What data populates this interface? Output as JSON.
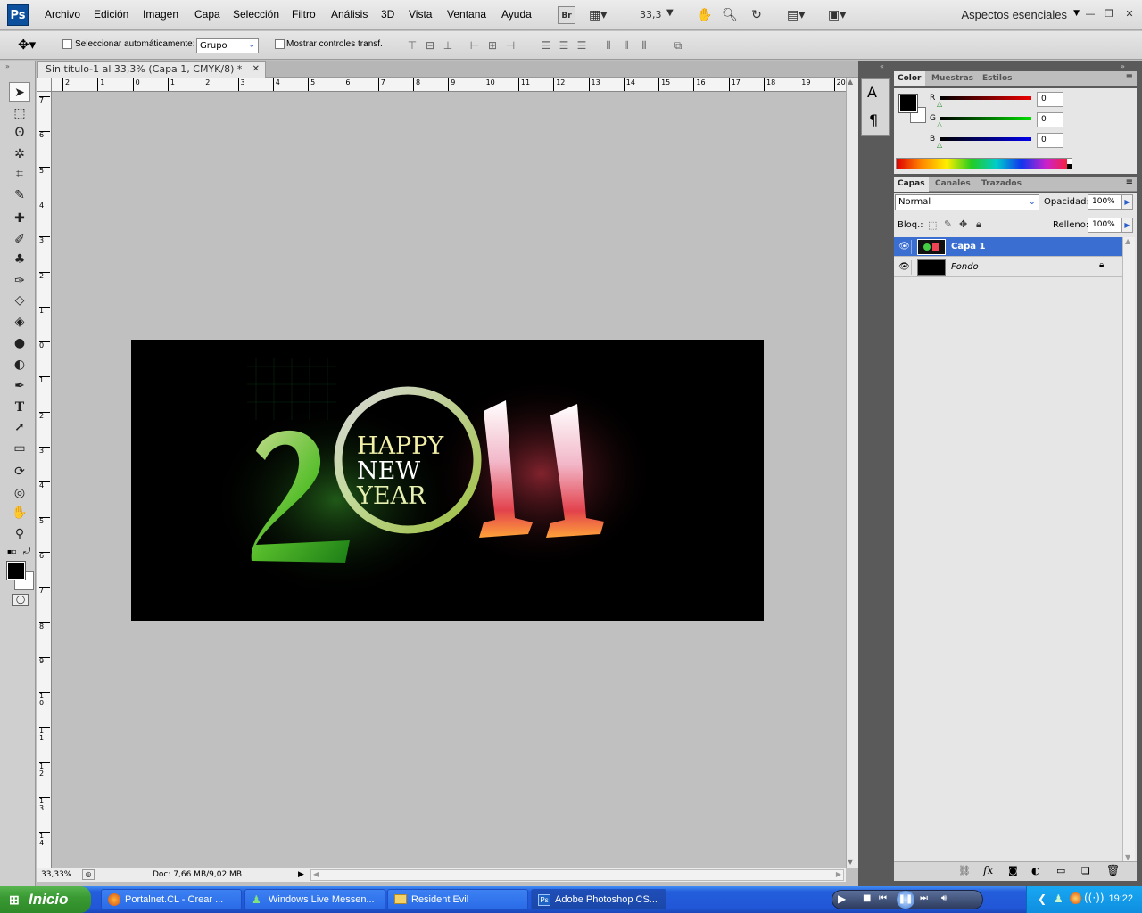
{
  "app": {
    "logo": "Ps",
    "workspace": "Aspectos esenciales"
  },
  "menu": [
    "Archivo",
    "Edición",
    "Imagen",
    "Capa",
    "Selección",
    "Filtro",
    "Análisis",
    "3D",
    "Vista",
    "Ventana",
    "Ayuda"
  ],
  "toolbar": {
    "bridge": "Br",
    "zoom": "33,3"
  },
  "options": {
    "auto_select_label": "Seleccionar automáticamente:",
    "auto_select_value": "Grupo",
    "show_transform_label": "Mostrar controles transf."
  },
  "document": {
    "tab_title": "Sin título-1 al 33,3% (Capa 1, CMYK/8) *",
    "zoom_status": "33,33%",
    "doc_info": "Doc: 7,66 MB/9,02 MB"
  },
  "artwork": {
    "line1": "HAPPY",
    "line2": "NEW",
    "line3": "YEAR",
    "year_left": "2",
    "year_right": "11"
  },
  "ruler_top": [
    "2",
    "1",
    "0",
    "1",
    "2",
    "3",
    "4",
    "5",
    "6",
    "7",
    "8",
    "9",
    "10",
    "11",
    "12",
    "13",
    "14",
    "15",
    "16",
    "17",
    "18",
    "19",
    "20"
  ],
  "ruler_left": [
    "7",
    "6",
    "5",
    "4",
    "3",
    "2",
    "1",
    "0",
    "1",
    "2",
    "3",
    "4",
    "5",
    "6",
    "7",
    "8",
    "9",
    "1\n0",
    "1\n1",
    "1\n2",
    "1\n3",
    "1\n4"
  ],
  "color_panel": {
    "tabs": [
      "Color",
      "Muestras",
      "Estilos"
    ],
    "r_label": "R",
    "g_label": "G",
    "b_label": "B",
    "r": "0",
    "g": "0",
    "b": "0"
  },
  "layers_panel": {
    "tabs": [
      "Capas",
      "Canales",
      "Trazados"
    ],
    "blend_mode": "Normal",
    "opacity_label": "Opacidad:",
    "opacity": "100%",
    "lock_label": "Bloq.:",
    "fill_label": "Relleno:",
    "fill": "100%",
    "layers": [
      {
        "name": "Capa 1",
        "selected": true
      },
      {
        "name": "Fondo",
        "selected": false
      }
    ]
  },
  "taskbar": {
    "start": "Inicio",
    "tasks": [
      "Portalnet.CL - Crear ...",
      "Windows Live Messen...",
      "Resident Evil",
      "Adobe Photoshop CS..."
    ],
    "clock": "19:22"
  }
}
